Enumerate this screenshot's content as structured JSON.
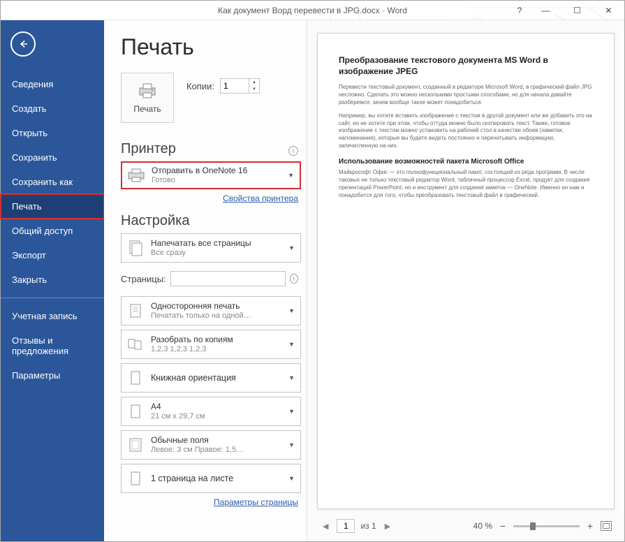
{
  "window": {
    "doc_name": "Как документ Ворд перевести в JPG.docx",
    "app_name": "Word",
    "help": "?",
    "minimize": "—",
    "maximize": "☐",
    "close": "✕"
  },
  "sidebar": {
    "items": [
      "Сведения",
      "Создать",
      "Открыть",
      "Сохранить",
      "Сохранить как",
      "Печать",
      "Общий доступ",
      "Экспорт",
      "Закрыть"
    ],
    "items2": [
      "Учетная запись",
      "Отзывы и предложения",
      "Параметры"
    ],
    "active_index": 5
  },
  "print": {
    "title": "Печать",
    "button": "Печать",
    "copies_label": "Копии:",
    "copies_value": "1"
  },
  "printer": {
    "section": "Принтер",
    "name": "Отправить в OneNote 16",
    "status": "Готово",
    "props_link": "Свойства принтера"
  },
  "settings": {
    "section": "Настройка",
    "all_pages": {
      "t1": "Напечатать все страницы",
      "t2": "Все сразу"
    },
    "pages_label": "Страницы:",
    "pages_value": "",
    "one_side": {
      "t1": "Односторонняя печать",
      "t2": "Печатать только на одной…"
    },
    "collate": {
      "t1": "Разобрать по копиям",
      "t2": "1,2,3   1,2,3   1,2,3"
    },
    "orient": {
      "t1": "Книжная ориентация"
    },
    "paper": {
      "t1": "A4",
      "t2": "21 см x 29,7 см"
    },
    "margins": {
      "t1": "Обычные поля",
      "t2": "Левое: 3 см  Правое: 1,5…"
    },
    "per_sheet": {
      "t1": "1 страница на листе"
    },
    "page_setup_link": "Параметры страницы"
  },
  "preview": {
    "h1": "Преобразование текстового документа MS Word в изображение JPEG",
    "p1": "Перевести текстовый документ, созданный в редакторе Microsoft Word, в графический файл JPG несложно. Сделать это можно несколькими простыми способами, но для начала давайте разберемся, зачем вообще такое может понадобиться.",
    "p2": "Например, вы хотите вставить изображение с текстом в другой документ или же добавить это на сайт, но не хотите при этом, чтобы оттуда можно было скопировать текст. Также, готовое изображение с текстом можно установить на рабочий стол в качестве обоев (заметки, напоминания), которые вы будете видеть постоянно и перечитывать информацию, запечатленную на них.",
    "h2": "Использование возможностей пакета Microsoft Office",
    "p3": "Майкрософт Офис — это полнофункциональный пакет, состоящий из ряда программ. В числе таковых не только текстовый редактор Word, табличный процессор Excel, продукт для создания презентаций PowerPoint, но и инструмент для создания заметок — OneNote. Именно он нам и понадобится для того, чтобы преобразовать текстовый файл в графический.",
    "page_current": "1",
    "page_total": "из 1",
    "zoom": "40 %"
  }
}
